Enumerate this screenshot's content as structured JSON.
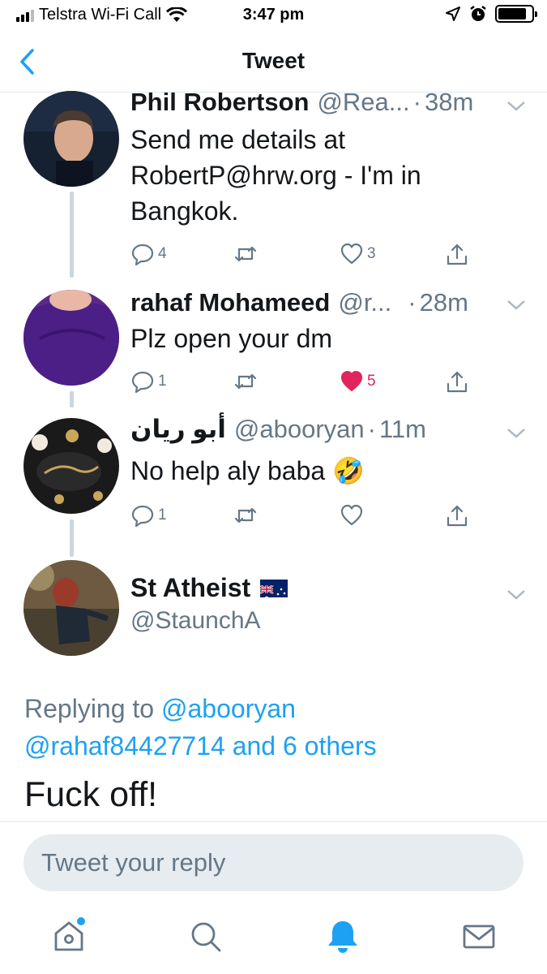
{
  "status_bar": {
    "carrier": "Telstra Wi-Fi Call",
    "time": "3:47 pm",
    "battery_level": 0.85
  },
  "nav": {
    "title": "Tweet"
  },
  "tweets": [
    {
      "name": "Phil Robertson",
      "handle": "@Rea...",
      "time": "38m",
      "text": "Send me details at RobertP@hrw.org - I'm in Bangkok.",
      "replies": "4",
      "retweets": "",
      "likes": "3",
      "liked": false
    },
    {
      "name": "rahaf Mohameed",
      "handle": "@r...",
      "time": "28m",
      "text": "Plz open your dm",
      "replies": "1",
      "retweets": "",
      "likes": "5",
      "liked": true
    },
    {
      "name": "أبو ريان",
      "handle": "@abooryan",
      "time": "11m",
      "text": "No help aly baba 🤣",
      "replies": "1",
      "retweets": "",
      "likes": "",
      "liked": false
    }
  ],
  "main_tweet": {
    "name": "St Atheist",
    "flag": "Australia",
    "handle": "@StaunchA",
    "replying_prefix": "Replying to",
    "reply_to_1": "@abooryan",
    "reply_to_2": "@rahaf84427714",
    "reply_to_suffix": "and 6 others",
    "text": "Fuck off!"
  },
  "composer": {
    "placeholder": "Tweet your reply"
  },
  "tabs": [
    {
      "icon": "home-icon",
      "has_notification_dot": true
    },
    {
      "icon": "search-icon"
    },
    {
      "icon": "bell-icon",
      "active": true
    },
    {
      "icon": "mail-icon"
    }
  ],
  "colors": {
    "accent": "#1da1f2",
    "like": "#e0245e",
    "secondary_text": "#657786",
    "composer_bg": "#e6ecf0"
  }
}
